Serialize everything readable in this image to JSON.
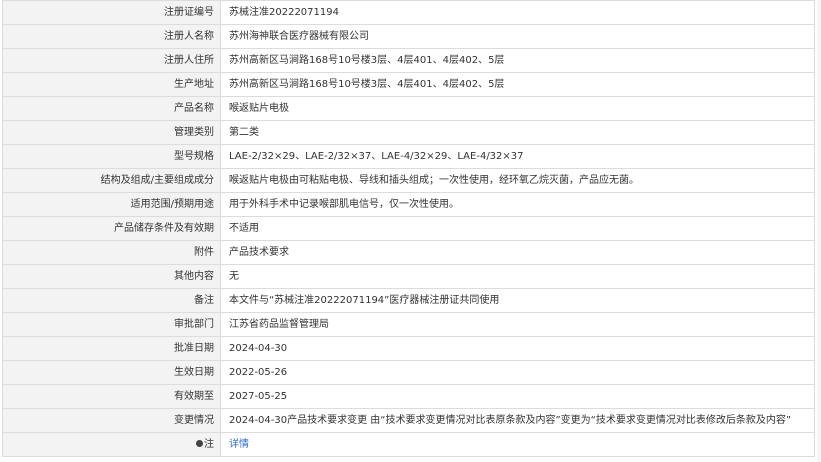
{
  "rows": [
    {
      "label": "注册证编号",
      "value": "苏械注准20222071194"
    },
    {
      "label": "注册人名称",
      "value": "苏州海神联合医疗器械有限公司"
    },
    {
      "label": "注册人住所",
      "value": "苏州高新区马涧路168号10号楼3层、4层401、4层402、5层"
    },
    {
      "label": "生产地址",
      "value": "苏州高新区马涧路168号10号楼3层、4层401、4层402、5层"
    },
    {
      "label": "产品名称",
      "value": "喉返贴片电极"
    },
    {
      "label": "管理类别",
      "value": "第二类"
    },
    {
      "label": "型号规格",
      "value": "LAE-2/32×29、LAE-2/32×37、LAE-4/32×29、LAE-4/32×37"
    },
    {
      "label": "结构及组成/主要组成成分",
      "value": "喉返贴片电极由可粘贴电极、导线和插头组成；一次性使用，经环氧乙烷灭菌，产品应无菌。"
    },
    {
      "label": "适用范围/预期用途",
      "value": "用于外科手术中记录喉部肌电信号，仅一次性使用。"
    },
    {
      "label": "产品储存条件及有效期",
      "value": "不适用"
    },
    {
      "label": "附件",
      "value": "产品技术要求"
    },
    {
      "label": "其他内容",
      "value": "无"
    },
    {
      "label": "备注",
      "value": "本文件与“苏械注准20222071194”医疗器械注册证共同使用"
    },
    {
      "label": "审批部门",
      "value": "江苏省药品监督管理局"
    },
    {
      "label": "批准日期",
      "value": "2024-04-30"
    },
    {
      "label": "生效日期",
      "value": "2022-05-26"
    },
    {
      "label": "有效期至",
      "value": "2027-05-25"
    },
    {
      "label": "变更情况",
      "value": "2024-04-30产品技术要求变更 由“技术要求变更情况对比表原条款及内容”变更为“技术要求变更情况对比表修改后条款及内容”"
    }
  ],
  "note_row": {
    "label": "注",
    "icon": "info-dot-icon",
    "link": "详情"
  }
}
